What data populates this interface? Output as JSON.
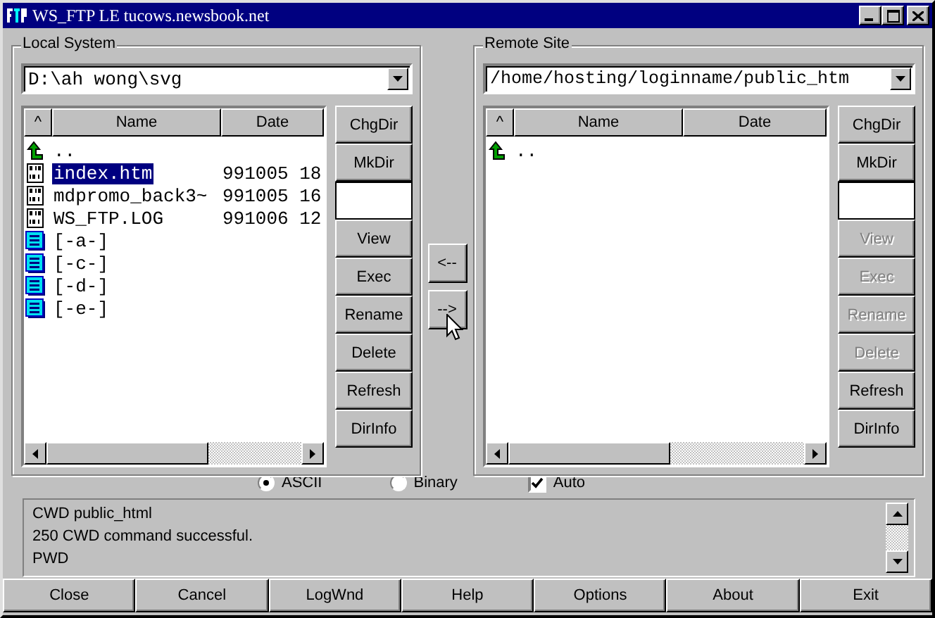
{
  "window": {
    "title": "WS_FTP LE tucows.newsbook.net"
  },
  "panels": [
    {
      "label": "Local System",
      "path": "D:\\ah wong\\svg",
      "columns": [
        "^",
        "Name",
        "Date"
      ],
      "rows": [
        {
          "kind": "up",
          "name": "..",
          "selected": false
        },
        {
          "kind": "file",
          "name": "index.htm",
          "date": "991005 18",
          "selected": true
        },
        {
          "kind": "file",
          "name": "mdpromo_back3~",
          "date": "991005 16",
          "selected": false
        },
        {
          "kind": "file",
          "name": "WS_FTP.LOG",
          "date": "991006 12",
          "selected": false
        },
        {
          "kind": "drive",
          "name": "[-a-]",
          "selected": false
        },
        {
          "kind": "drive",
          "name": "[-c-]",
          "selected": false
        },
        {
          "kind": "drive",
          "name": "[-d-]",
          "selected": false
        },
        {
          "kind": "drive",
          "name": "[-e-]",
          "selected": false
        }
      ],
      "buttons": [
        {
          "kind": "button",
          "label": "ChgDir",
          "disabled": false
        },
        {
          "kind": "button",
          "label": "MkDir",
          "disabled": false
        },
        {
          "kind": "field"
        },
        {
          "kind": "button",
          "label": "View",
          "disabled": false
        },
        {
          "kind": "button",
          "label": "Exec",
          "disabled": false
        },
        {
          "kind": "button",
          "label": "Rename",
          "disabled": false
        },
        {
          "kind": "button",
          "label": "Delete",
          "disabled": false
        },
        {
          "kind": "button",
          "label": "Refresh",
          "disabled": false
        },
        {
          "kind": "button",
          "label": "DirInfo",
          "disabled": false
        }
      ]
    },
    {
      "label": "Remote Site",
      "path": "/home/hosting/loginname/public_htm",
      "columns": [
        "^",
        "Name",
        "Date"
      ],
      "rows": [
        {
          "kind": "up",
          "name": "..",
          "selected": false
        }
      ],
      "buttons": [
        {
          "kind": "button",
          "label": "ChgDir",
          "disabled": false
        },
        {
          "kind": "button",
          "label": "MkDir",
          "disabled": false
        },
        {
          "kind": "field"
        },
        {
          "kind": "button",
          "label": "View",
          "disabled": true
        },
        {
          "kind": "button",
          "label": "Exec",
          "disabled": true
        },
        {
          "kind": "button",
          "label": "Rename",
          "disabled": true
        },
        {
          "kind": "button",
          "label": "Delete",
          "disabled": true
        },
        {
          "kind": "button",
          "label": "Refresh",
          "disabled": false
        },
        {
          "kind": "button",
          "label": "DirInfo",
          "disabled": false
        }
      ]
    }
  ],
  "transfer_buttons": [
    "<--",
    "-->"
  ],
  "modes": [
    {
      "label": "ASCII",
      "selected": true
    },
    {
      "label": "Binary",
      "selected": false
    }
  ],
  "auto": {
    "label": "Auto",
    "checked": true
  },
  "log": [
    "CWD public_html",
    "250 CWD command successful.",
    "PWD"
  ],
  "bottom_buttons": [
    "Close",
    "Cancel",
    "LogWnd",
    "Help",
    "Options",
    "About",
    "Exit"
  ]
}
